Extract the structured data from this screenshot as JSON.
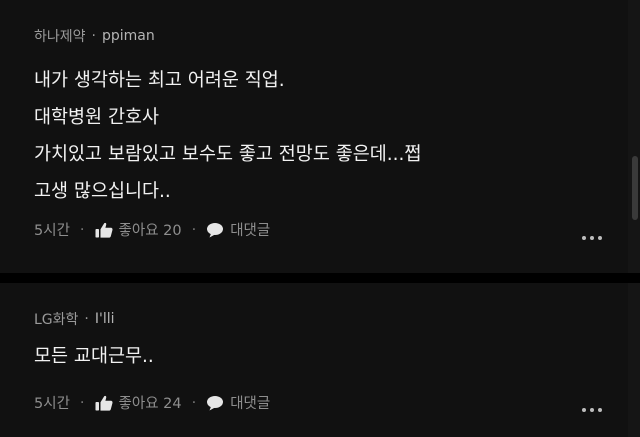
{
  "comments": [
    {
      "company": "하나제약",
      "separator": "·",
      "nickname": "ppiman",
      "lines": [
        "내가 생각하는 최고 어려운 직업.",
        "대학병원 간호사",
        "가치있고 보람있고 보수도 좋고 전망도 좋은데...쩝",
        "고생 많으십니다.."
      ],
      "time": "5시간",
      "like_label": "좋아요 20",
      "reply_label": "대댓글",
      "dot": "·"
    },
    {
      "company": "LG화학",
      "separator": "·",
      "nickname": "I'lli",
      "lines": [
        "모든 교대근무.."
      ],
      "time": "5시간",
      "like_label": "좋아요 24",
      "reply_label": "대댓글",
      "dot": "·"
    }
  ],
  "icons": {
    "like": "thumbs-up-icon",
    "reply": "speech-bubble-icon",
    "more": "more-horizontal-icon"
  },
  "colors": {
    "background": "#111111",
    "text": "#f2f2f2",
    "muted": "#8e8e8e"
  }
}
